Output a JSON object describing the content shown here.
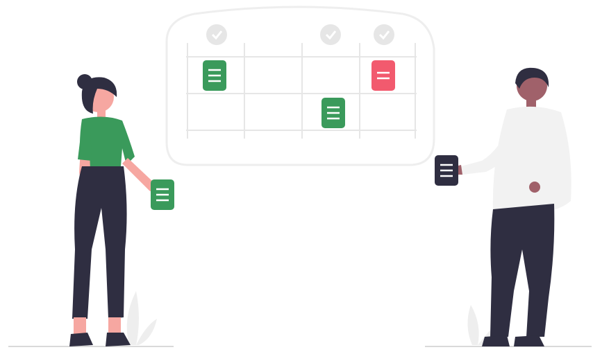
{
  "illustration": {
    "colors": {
      "board_outline": "#eeeeee",
      "board_grid": "#e8e8e8",
      "check_circle": "#e6e6e6",
      "accent_green": "#3a9a5b",
      "accent_red": "#f25a6e",
      "dark": "#2f2e41",
      "shirt_light": "#f2f2f2",
      "skin": "#f6a7a1",
      "skin_dark": "#a0616a",
      "hair": "#2f2e41",
      "ground": "#d9d9d9",
      "plant": "#e6e6e6"
    },
    "icons": {
      "check": "check-icon",
      "document": "document-icon"
    },
    "board": {
      "columns": 4,
      "rows": 2,
      "checked_columns": [
        1,
        3,
        4
      ],
      "cards": [
        {
          "column": 1,
          "row": 1,
          "color": "accent_green"
        },
        {
          "column": 4,
          "row": 1,
          "color": "accent_red"
        },
        {
          "column": 3,
          "row": 2,
          "color": "accent_green"
        }
      ]
    },
    "figures": [
      {
        "name": "woman",
        "holding_card_color": "accent_green"
      },
      {
        "name": "man",
        "holding_card_color": "dark"
      }
    ]
  }
}
